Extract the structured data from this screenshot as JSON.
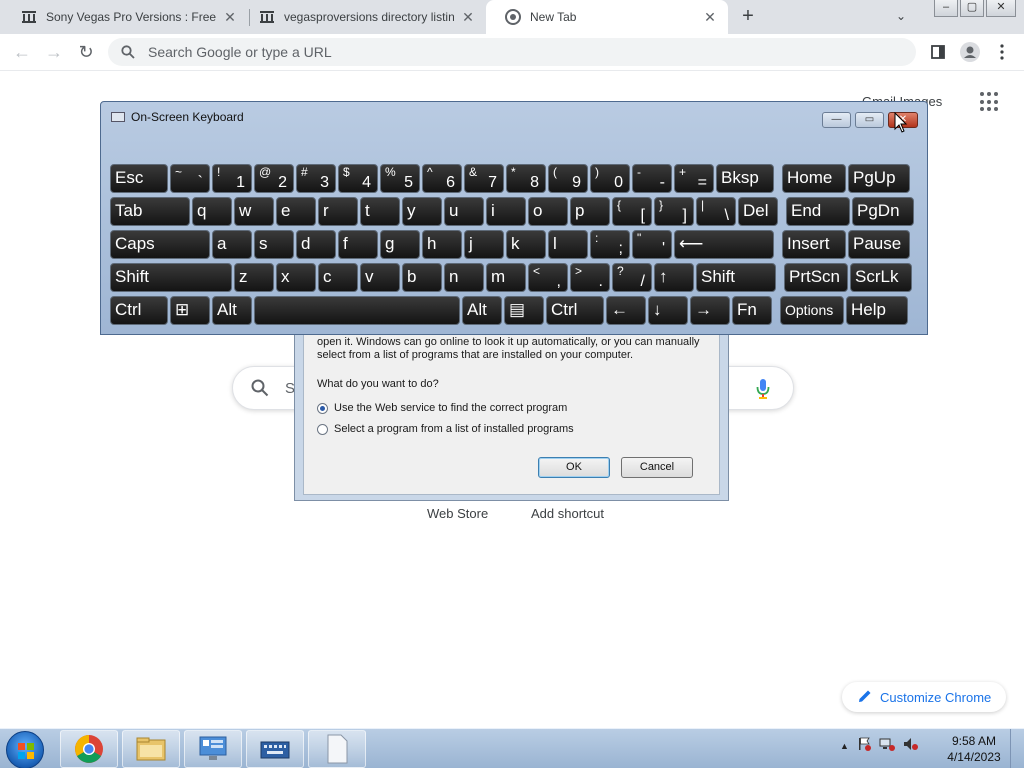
{
  "browser": {
    "tabs": [
      {
        "title": "Sony Vegas Pro Versions : Free D",
        "favicon": "archive-icon",
        "active": false
      },
      {
        "title": "vegasproversions directory listing",
        "favicon": "archive-icon",
        "active": false
      },
      {
        "title": "New Tab",
        "favicon": "chrome-icon",
        "active": true
      }
    ],
    "new_tab_symbol": "+",
    "tab_menu_symbol": "⌄",
    "window_controls": {
      "minimize": "–",
      "restore": "▢",
      "close": "✕"
    },
    "nav": {
      "back": "←",
      "forward": "→",
      "reload": "↻"
    },
    "omnibox_placeholder": "Search Google or type a URL"
  },
  "ntp": {
    "top_links": "Gmail   Images",
    "search_placeholder": "S",
    "shortcuts": [
      {
        "label": "Web Store"
      },
      {
        "label": "Add shortcut"
      }
    ],
    "customize_label": "Customize Chrome"
  },
  "open_with_dialog": {
    "description_lines": [
      "open it. Windows can go online to look it up automatically, or you can manually",
      "select from a list of programs that are installed on your computer."
    ],
    "question": "What do you want to do?",
    "options": [
      {
        "label": "Use the Web service to find the correct program",
        "selected": true
      },
      {
        "label": "Select a program from a list of installed programs",
        "selected": false
      }
    ],
    "ok_label": "OK",
    "cancel_label": "Cancel"
  },
  "osk": {
    "title": "On-Screen Keyboard",
    "controls": {
      "minimize": "—",
      "restore": "▭",
      "close": "✕"
    },
    "rows": [
      [
        {
          "label": "Esc"
        },
        {
          "small": "~",
          "big": "`"
        },
        {
          "small": "!",
          "big": "1"
        },
        {
          "small": "@",
          "big": "2"
        },
        {
          "small": "#",
          "big": "3"
        },
        {
          "small": "$",
          "big": "4"
        },
        {
          "small": "%",
          "big": "5"
        },
        {
          "small": "^",
          "big": "6"
        },
        {
          "small": "&",
          "big": "7"
        },
        {
          "small": "*",
          "big": "8"
        },
        {
          "small": "(",
          "big": "9"
        },
        {
          "small": ")",
          "big": "0"
        },
        {
          "small": "-",
          "big": "-"
        },
        {
          "small": "+",
          "big": "="
        },
        {
          "label": "Bksp"
        },
        {
          "label": "Home"
        },
        {
          "label": "PgUp"
        }
      ],
      [
        {
          "label": "Tab"
        },
        {
          "label": "q"
        },
        {
          "label": "w"
        },
        {
          "label": "e"
        },
        {
          "label": "r"
        },
        {
          "label": "t"
        },
        {
          "label": "y"
        },
        {
          "label": "u"
        },
        {
          "label": "i"
        },
        {
          "label": "o"
        },
        {
          "label": "p"
        },
        {
          "small": "{",
          "big": "["
        },
        {
          "small": "}",
          "big": "]"
        },
        {
          "small": "|",
          "big": "\\"
        },
        {
          "label": "Del"
        },
        {
          "label": "End"
        },
        {
          "label": "PgDn"
        }
      ],
      [
        {
          "label": "Caps"
        },
        {
          "label": "a"
        },
        {
          "label": "s"
        },
        {
          "label": "d"
        },
        {
          "label": "f"
        },
        {
          "label": "g"
        },
        {
          "label": "h"
        },
        {
          "label": "j"
        },
        {
          "label": "k"
        },
        {
          "label": "l"
        },
        {
          "small": ":",
          "big": ";"
        },
        {
          "small": "\"",
          "big": "'"
        },
        {
          "label": "⟵"
        },
        {
          "label": "Insert"
        },
        {
          "label": "Pause"
        }
      ],
      [
        {
          "label": "Shift"
        },
        {
          "label": "z"
        },
        {
          "label": "x"
        },
        {
          "label": "c"
        },
        {
          "label": "v"
        },
        {
          "label": "b"
        },
        {
          "label": "n"
        },
        {
          "label": "m"
        },
        {
          "small": "<",
          "big": ","
        },
        {
          "small": ">",
          "big": "."
        },
        {
          "small": "?",
          "big": "/"
        },
        {
          "label": "↑"
        },
        {
          "label": "Shift"
        },
        {
          "label": "PrtScn"
        },
        {
          "label": "ScrLk"
        }
      ],
      [
        {
          "label": "Ctrl"
        },
        {
          "label": "⊞"
        },
        {
          "label": "Alt"
        },
        {
          "label": ""
        },
        {
          "label": "Alt"
        },
        {
          "label": "▤"
        },
        {
          "label": "Ctrl"
        },
        {
          "label": "←"
        },
        {
          "label": "↓"
        },
        {
          "label": "→"
        },
        {
          "label": "Fn"
        },
        {
          "label": "Options"
        },
        {
          "label": "Help"
        }
      ]
    ]
  },
  "taskbar": {
    "apps": [
      "chrome-icon",
      "file-explorer-icon",
      "control-panel-icon",
      "on-screen-keyboard-icon",
      "blank-document-icon"
    ],
    "clock_time": "9:58 AM",
    "clock_date": "4/14/2023",
    "tray_arrow": "▲"
  },
  "colors": {
    "osk_frame": "#b9cbe2",
    "key_face": "#1e1e1e",
    "taskbar": "#9ab4d2",
    "link_blue": "#1a73e8"
  }
}
